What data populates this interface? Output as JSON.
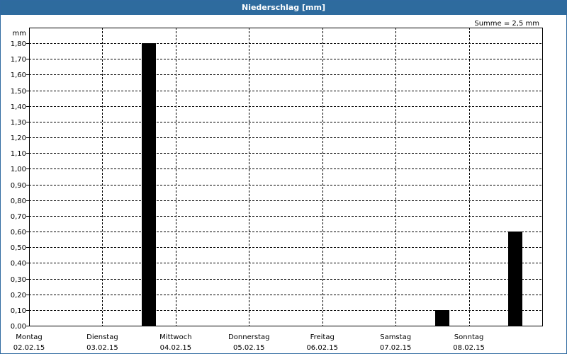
{
  "window": {
    "title": "Niederschlag [mm]"
  },
  "chart_data": {
    "type": "bar",
    "title": "Niederschlag [mm]",
    "annotation": "Summe = 2,5 mm",
    "ylabel": "mm",
    "xlabel": "",
    "ylim": [
      0,
      1.8
    ],
    "ytick_step": 0.1,
    "yticks": [
      "0,00",
      "0,10",
      "0,20",
      "0,30",
      "0,40",
      "0,50",
      "0,60",
      "0,70",
      "0,80",
      "0,90",
      "1,00",
      "1,10",
      "1,20",
      "1,30",
      "1,40",
      "1,50",
      "1,60",
      "1,70",
      "1,80"
    ],
    "categories": [
      {
        "day": "Montag",
        "date": "02.02.15"
      },
      {
        "day": "Dienstag",
        "date": "03.02.15"
      },
      {
        "day": "Mittwoch",
        "date": "04.02.15"
      },
      {
        "day": "Donnerstag",
        "date": "05.02.15"
      },
      {
        "day": "Freitag",
        "date": "06.02.15"
      },
      {
        "day": "Samstag",
        "date": "07.02.15"
      },
      {
        "day": "Sonntag",
        "date": "08.02.15"
      }
    ],
    "values": [
      0,
      1.8,
      0,
      0,
      0,
      0.1,
      0.6
    ],
    "grid": true,
    "colors": {
      "bar": "#000000",
      "grid": "#000000",
      "title_bar": "#2e6b9e",
      "title_text": "#ffffff"
    }
  }
}
